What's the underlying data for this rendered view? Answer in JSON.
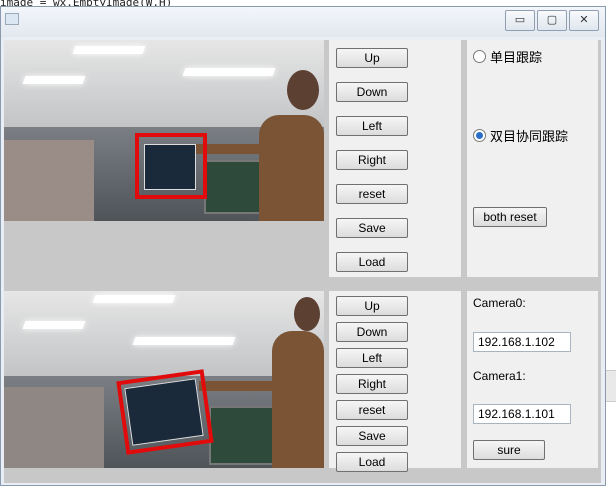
{
  "background_code": "image = wx.EmptyImage(W,H)",
  "window": {
    "title": "",
    "controls": {
      "minimize": "▭",
      "maximize": "▢",
      "close": "✕"
    }
  },
  "camera0_panel": {
    "buttons": [
      "Up",
      "Down",
      "Left",
      "Right",
      "reset",
      "Save",
      "Load"
    ]
  },
  "camera1_panel": {
    "buttons": [
      "Up",
      "Down",
      "Left",
      "Right",
      "reset",
      "Save",
      "Load"
    ]
  },
  "mode_panel": {
    "radio_single": "单目跟踪",
    "radio_dual": "双目协同跟踪",
    "selected": "dual",
    "both_reset": "both reset"
  },
  "config_panel": {
    "camera0_label": "Camera0:",
    "camera0_ip": "192.168.1.102",
    "camera1_label": "Camera1:",
    "camera1_ip": "192.168.1.101",
    "sure": "sure"
  },
  "colors": {
    "tracking_box": "#e20b0b",
    "accent": "#2a6fc7"
  }
}
